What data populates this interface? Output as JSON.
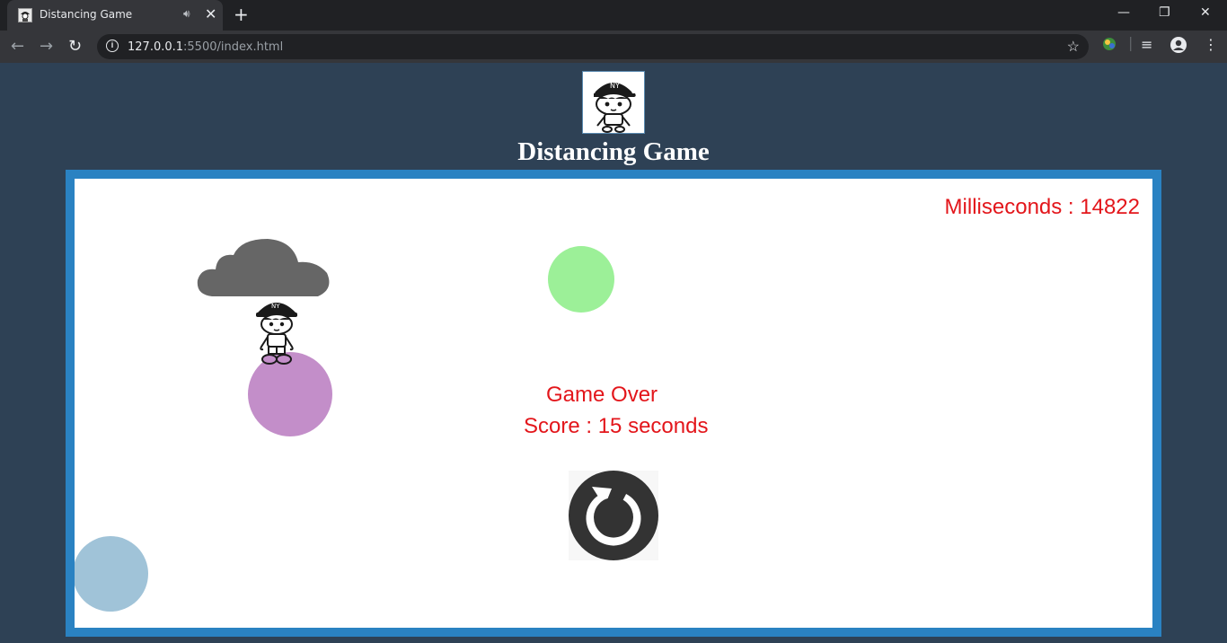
{
  "browser": {
    "tab_title": "Distancing Game",
    "url_host": "127.0.0.1",
    "url_path": ":5500/index.html"
  },
  "page": {
    "title": "Distancing Game"
  },
  "game": {
    "timer_text": "Milliseconds : 14822",
    "game_over_text": "Game Over",
    "score_text": "Score : 15 seconds"
  },
  "colors": {
    "background": "#2e4155",
    "frame": "#2a82c2",
    "text_red": "#e3161b",
    "circle_green": "#9cf098",
    "circle_purple": "#c38ec9",
    "circle_blue": "#a0c3d8",
    "cloud": "#666666"
  },
  "icons": {
    "restart": "restart-icon",
    "cloud": "cloud-icon",
    "player": "player-character",
    "logo": "boy-cap-logo"
  }
}
